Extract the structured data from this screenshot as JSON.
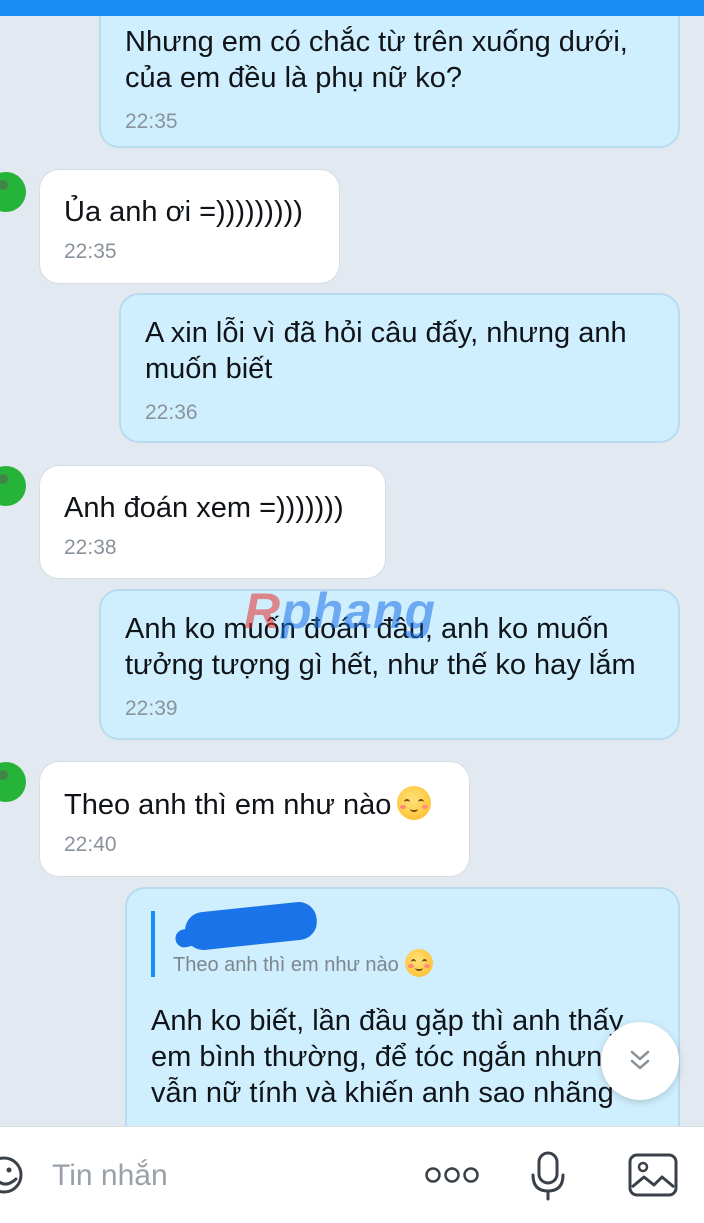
{
  "messages": [
    {
      "side": "out",
      "text": "Nhưng em có chắc từ trên xuống dưới, của em đều là phụ nữ ko?",
      "time": "22:35"
    },
    {
      "side": "in",
      "text": "Ủa anh ơi =)))))))))",
      "time": "22:35"
    },
    {
      "side": "out",
      "text": "A xin lỗi vì đã hỏi câu đấy, nhưng anh muốn biết",
      "time": "22:36"
    },
    {
      "side": "in",
      "text": "Anh đoán xem =)))))))",
      "time": "22:38"
    },
    {
      "side": "out",
      "text": "Anh ko muốn đoán đâu, anh ko muốn tưởng tượng gì hết, như thế ko hay lắm",
      "time": "22:39"
    },
    {
      "side": "in",
      "text": "Theo anh thì em như nào",
      "time": "22:40",
      "emoji": "blushing-smile"
    },
    {
      "side": "out",
      "quote": {
        "text": "Theo anh thì em như nào",
        "emoji": "blushing-smile"
      },
      "text": "Anh ko biết, lần đầu gặp thì anh thấy em bình thường, để tóc ngắn nhưng vẫn nữ tính và khiến anh sao nhãng"
    }
  ],
  "watermark": {
    "part1": "R",
    "part2": "phang"
  },
  "composer": {
    "placeholder": "Tin nhắn"
  },
  "icons": [
    "sticker-icon",
    "more-icon",
    "mic-icon",
    "image-icon",
    "scroll-down-icon"
  ],
  "colors": {
    "accent": "#1a8cf5",
    "outgoing_bubble": "#cfefff",
    "incoming_bubble": "#ffffff",
    "background": "#e2e9f1"
  }
}
